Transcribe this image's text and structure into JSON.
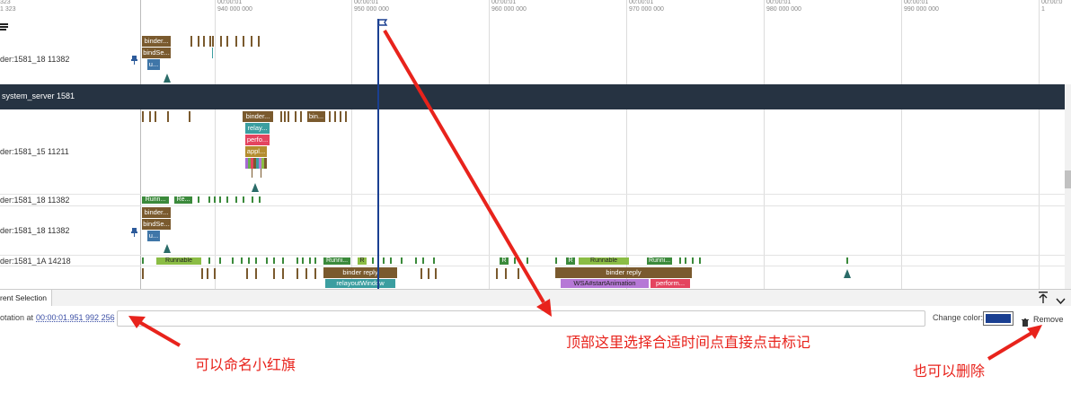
{
  "header": {
    "top_left_1": "323",
    "top_left_2": "1 323",
    "ticks": [
      {
        "label": "00:00:01\n940 000 000"
      },
      {
        "label": "00:00:01\n950 000 000"
      },
      {
        "label": "00:00:01\n960 000 000"
      },
      {
        "label": "00:00:01\n970 000 000"
      },
      {
        "label": "00:00:01\n980 000 000"
      },
      {
        "label": "00:00:01\n990 000 000"
      },
      {
        "label": "00:00:0\n1"
      }
    ]
  },
  "tracks": {
    "row1_label": "der:1581_18 11382",
    "process_header": "system_server 1581",
    "row2_label": "der:1581_15 11211",
    "row3_label": "der:1581_18 11382",
    "row4_label": "der:1581_18 11382",
    "row5_label": "der:1581_1A 14218"
  },
  "slices": {
    "binder1": "binder...",
    "bindse1": "bindSe...",
    "u1": "u...",
    "binder2": "binder...",
    "relay2": "relay...",
    "perfo2": "perfo...",
    "appl2": "appl...",
    "bin2b": "bin...",
    "runn3": "Runn...",
    "re3": "Re...",
    "binder4": "binder...",
    "bindse4": "bindSe...",
    "u4": "u...",
    "runnable5": "Runnable",
    "runni5": "Runni...",
    "r5": "R",
    "r5b": "R",
    "r5c": "R",
    "runnable5b": "Runnable",
    "runni5b": "Runni...",
    "binder_reply_a": "binder reply",
    "relayout": "relayoutWindow",
    "binder_reply_b": "binder reply",
    "wsa": "WSA#startAnimation",
    "perform": "perform..."
  },
  "panel": {
    "tab": "rent Selection",
    "annotation_prefix": "otation at ",
    "annotation_time": "00:00:01.951 992 256",
    "name_input_value": "",
    "change_color_label": "Change color:",
    "color_value": "#1a3f91",
    "remove_label": "Remove"
  },
  "annotations": {
    "top": "顶部这里选择合适时间点直接点击标记",
    "left": "可以命名小红旗",
    "right": "也可以删除"
  },
  "colors": {
    "marker": "#1a3f91",
    "arrow": "#e8231c"
  }
}
